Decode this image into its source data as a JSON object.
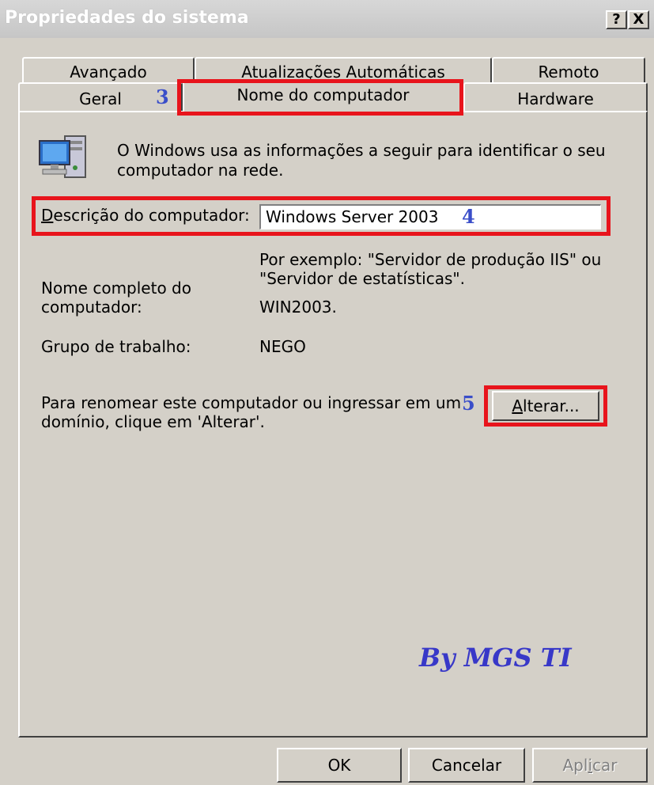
{
  "window": {
    "title": "Propriedades do sistema",
    "help_button": "?",
    "close_button": "X"
  },
  "tabs": {
    "row1": [
      "Avançado",
      "Atualizações Automáticas",
      "Remoto"
    ],
    "row2": [
      "Geral",
      "Nome do computador",
      "Hardware"
    ],
    "active": "Nome do computador"
  },
  "annotations": {
    "step3": "3",
    "step4": "4",
    "step5": "5",
    "signature": "By MGS TI",
    "highlight_color": "#e8141c",
    "number_color": "#3a4ec9"
  },
  "content": {
    "info_text_line1": "O Windows usa as informações a seguir para identificar o seu",
    "info_text_line2": "computador na rede.",
    "description_label_first": "D",
    "description_label_rest": "escrição do computador:",
    "description_value": "Windows Server 2003",
    "example_line1": "Por exemplo: \"Servidor de produção IIS\" ou",
    "example_line2": "\"Servidor de estatísticas\".",
    "full_name_label_line1": "Nome completo do",
    "full_name_label_line2": "computador:",
    "full_name_value": "WIN2003.",
    "workgroup_label": "Grupo de trabalho:",
    "workgroup_value": "NEGO",
    "rename_text_line1": "Para renomear este computador ou ingressar em um",
    "rename_text_line2": "domínio, clique em 'Alterar'.",
    "change_button_first": "A",
    "change_button_rest": "lterar..."
  },
  "footer": {
    "ok": "OK",
    "cancel": "Cancelar",
    "apply_pre": "Apl",
    "apply_u": "i",
    "apply_post": "car"
  }
}
